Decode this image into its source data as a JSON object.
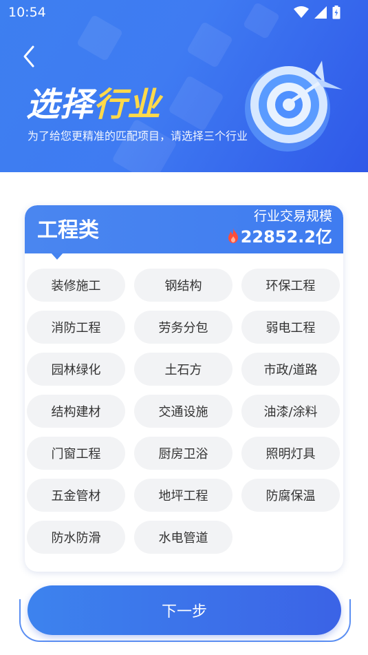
{
  "status_bar": {
    "time": "10:54"
  },
  "header": {
    "title_part1": "选择",
    "title_part2": "行业",
    "subtitle": "为了给您更精准的匹配项目，请选择三个行业"
  },
  "category": {
    "name": "工程类",
    "scale_label": "行业交易规模",
    "scale_value": "22852.2亿",
    "tags": [
      "装修施工",
      "钢结构",
      "环保工程",
      "消防工程",
      "劳务分包",
      "弱电工程",
      "园林绿化",
      "土石方",
      "市政/道路",
      "结构建材",
      "交通设施",
      "油漆/涂料",
      "门窗工程",
      "厨房卫浴",
      "照明灯具",
      "五金管材",
      "地坪工程",
      "防腐保温",
      "防水防滑",
      "水电管道"
    ]
  },
  "footer": {
    "next_label": "下一步"
  },
  "colors": {
    "accent": "#3f7cf0",
    "highlight": "#ffd94a",
    "tag_bg": "#f2f3f5"
  },
  "icons": [
    "back-arrow-icon",
    "wifi-icon",
    "signal-icon",
    "battery-icon",
    "fire-icon",
    "target-icon"
  ]
}
